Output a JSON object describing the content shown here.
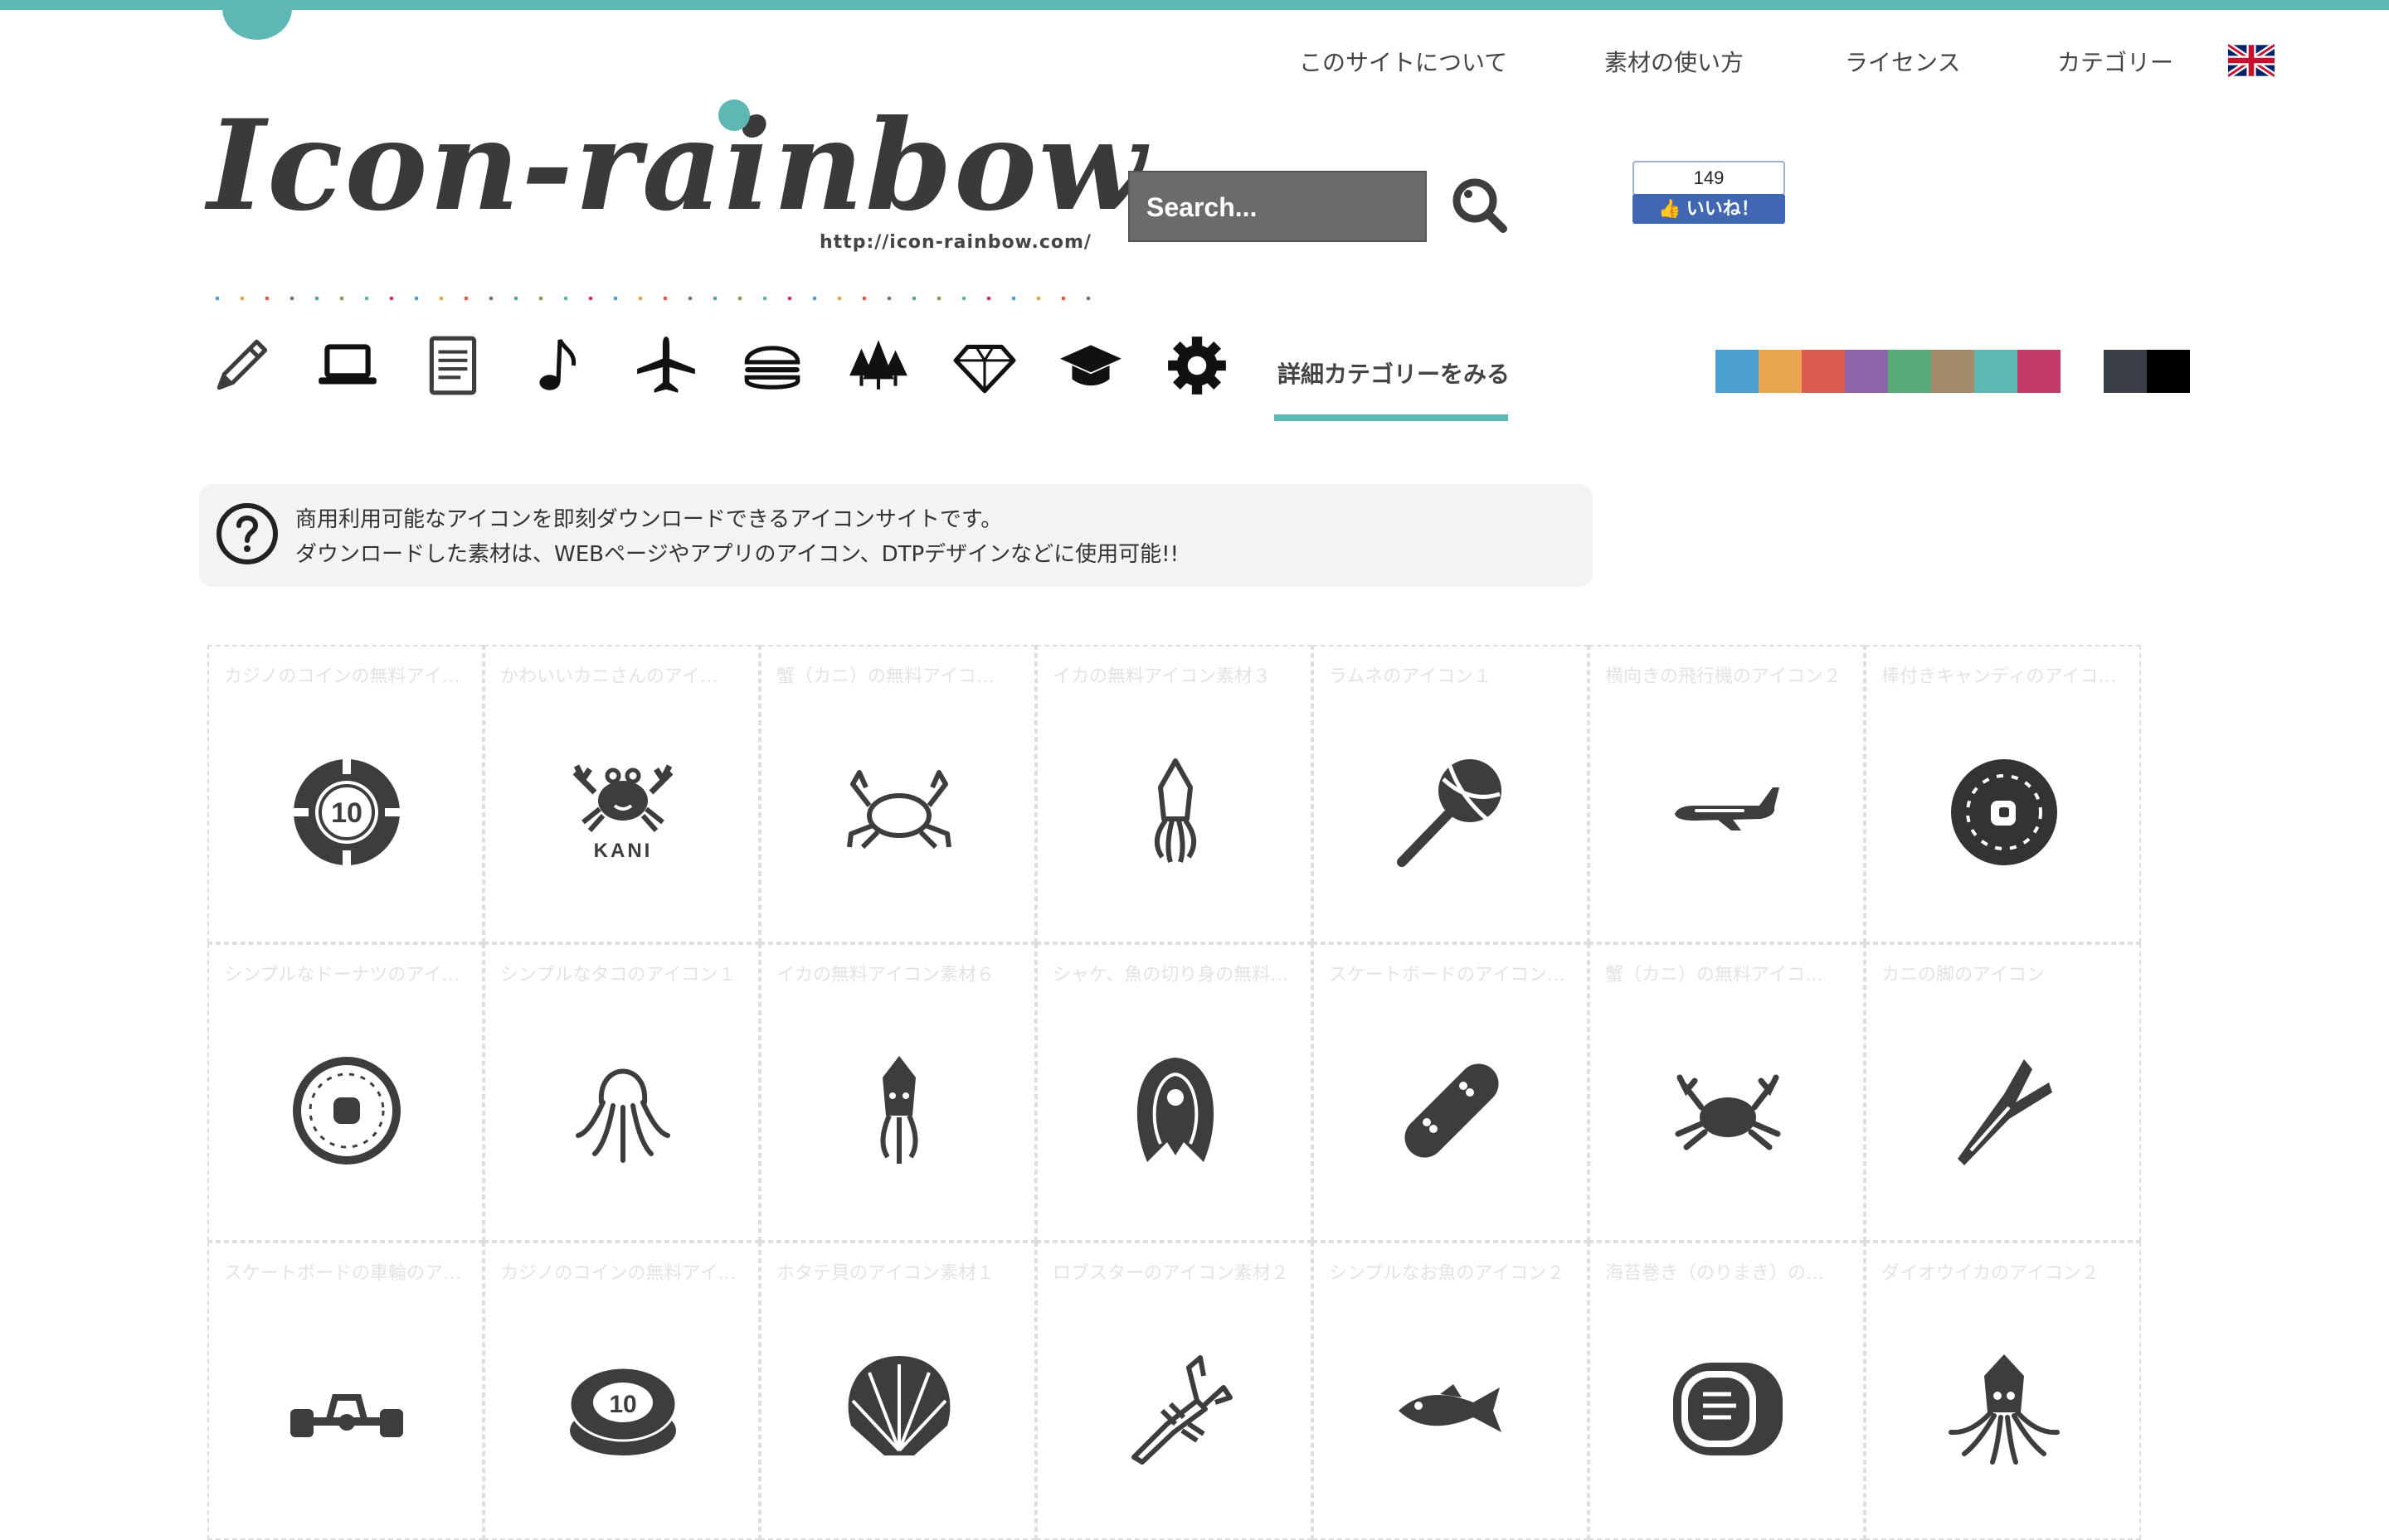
{
  "nav": {
    "about": "このサイトについて",
    "howto": "素材の使い方",
    "license": "ライセンス",
    "category": "カテゴリー"
  },
  "language_flag_icon": "uk-flag-icon",
  "logo": {
    "text": "Icon-rainbow",
    "url": "http://icon-rainbow.com/"
  },
  "search": {
    "placeholder": "Search...",
    "button_icon": "magnifier-icon"
  },
  "facebook": {
    "count": "149",
    "like_label": "いいね！"
  },
  "categories": {
    "icons": [
      "pencil-icon",
      "laptop-icon",
      "notebook-icon",
      "music-note-icon",
      "airplane-icon",
      "burger-icon",
      "trees-icon",
      "diamond-icon",
      "graduation-cap-icon",
      "gear-icon"
    ],
    "detail_label": "詳細カテゴリーをみる"
  },
  "colors": {
    "accent": "#5fb7b4",
    "icon": "#3d3d3d",
    "swatches": [
      "#4a9fcf",
      "#e9a54f",
      "#d95b4f",
      "#8c64a8",
      "#5aab7a",
      "#a48c6b",
      "#5fb7b4",
      "#c33b6b"
    ],
    "mono_swatches": [
      "#3a3f47",
      "#000000"
    ]
  },
  "intro": {
    "line1": "商用利用可能なアイコンを即刻ダウンロードできるアイコンサイトです。",
    "line2": "ダウンロードした素材は、WEBページやアプリのアイコン、DTPデザインなどに使用可能!!"
  },
  "icons": [
    {
      "title": "カジノのコインの無料アイ…",
      "icon": "casino-chip-icon"
    },
    {
      "title": "かわいいカニさんのアイ…",
      "icon": "crab-kani-icon"
    },
    {
      "title": "蟹（カニ）の無料アイコ…",
      "icon": "crab-outline-icon"
    },
    {
      "title": "イカの無料アイコン素材３",
      "icon": "squid-outline-icon"
    },
    {
      "title": "ラムネのアイコン１",
      "icon": "lollipop-icon"
    },
    {
      "title": "横向きの飛行機のアイコン２",
      "icon": "airplane-side-icon"
    },
    {
      "title": "棒付きキャンディのアイコ…",
      "icon": "candy-donut-icon"
    },
    {
      "title": "シンプルなドーナツのアイ…",
      "icon": "donut-icon"
    },
    {
      "title": "シンプルなタコのアイコン１",
      "icon": "octopus-icon"
    },
    {
      "title": "イカの無料アイコン素材６",
      "icon": "squid-icon"
    },
    {
      "title": "シャケ、魚の切り身の無料…",
      "icon": "salmon-slice-icon"
    },
    {
      "title": "スケートボードのアイコン…",
      "icon": "skateboard-icon"
    },
    {
      "title": "蟹（カニ）の無料アイコ…",
      "icon": "crab-icon"
    },
    {
      "title": "カニの脚のアイコン",
      "icon": "crab-leg-icon"
    },
    {
      "title": "スケートボードの車輪のア…",
      "icon": "skate-wheel-icon"
    },
    {
      "title": "カジノのコインの無料アイ…",
      "icon": "casino-chips-icon"
    },
    {
      "title": "ホタテ貝のアイコン素材１",
      "icon": "scallop-icon"
    },
    {
      "title": "ロブスターのアイコン素材２",
      "icon": "lobster-icon"
    },
    {
      "title": "シンプルなお魚のアイコン２",
      "icon": "fish-icon"
    },
    {
      "title": "海苔巻き（のりまき）の…",
      "icon": "sushi-roll-icon"
    },
    {
      "title": "ダイオウイカのアイコン２",
      "icon": "giant-squid-icon"
    }
  ]
}
